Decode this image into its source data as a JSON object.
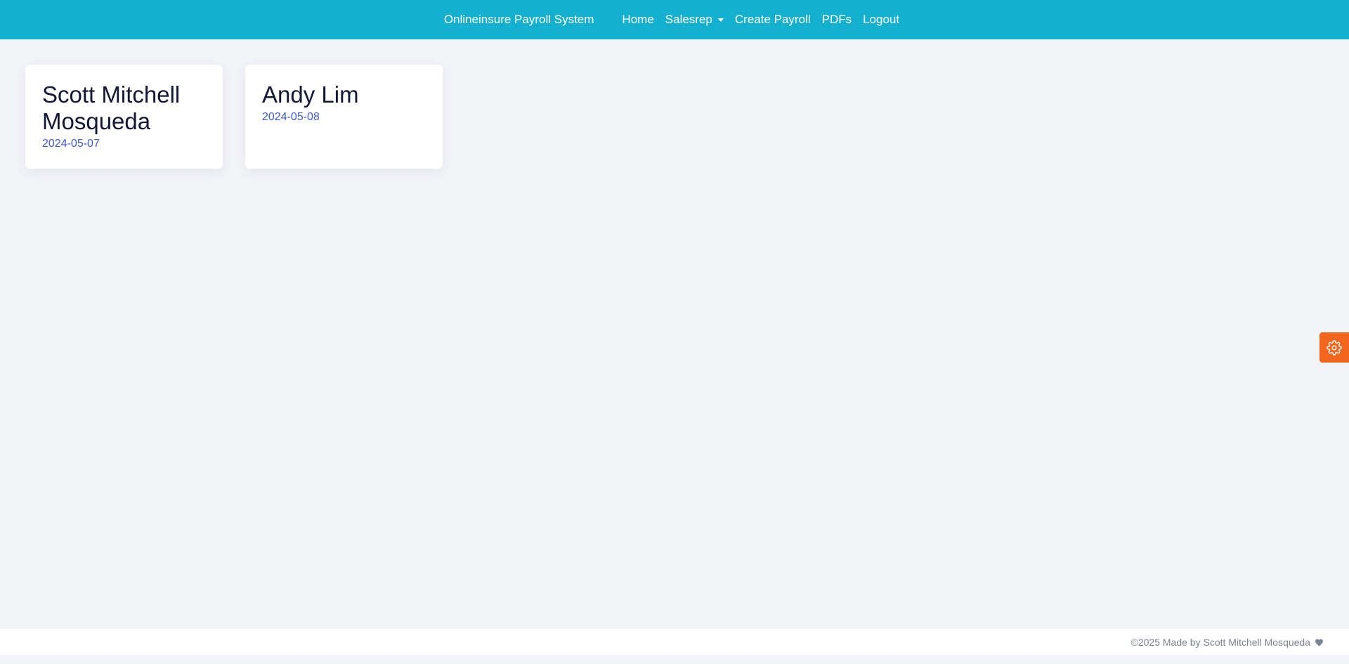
{
  "navbar": {
    "brand": "Onlineinsure Payroll System",
    "links": {
      "home": "Home",
      "salesrep": "Salesrep",
      "create_payroll": "Create Payroll",
      "pdfs": "PDFs",
      "logout": "Logout"
    },
    "background_color": "#13b0cf"
  },
  "cards": [
    {
      "name": "Scott Mitchell Mosqueda",
      "date": "2024-05-07"
    },
    {
      "name": "Andy Lim",
      "date": "2024-05-08"
    }
  ],
  "settings_button": {
    "icon": "gear-icon",
    "color": "#f2651c"
  },
  "footer": {
    "text": "©2025 Made by Scott Mitchell Mosqueda",
    "icon": "heart-icon"
  }
}
